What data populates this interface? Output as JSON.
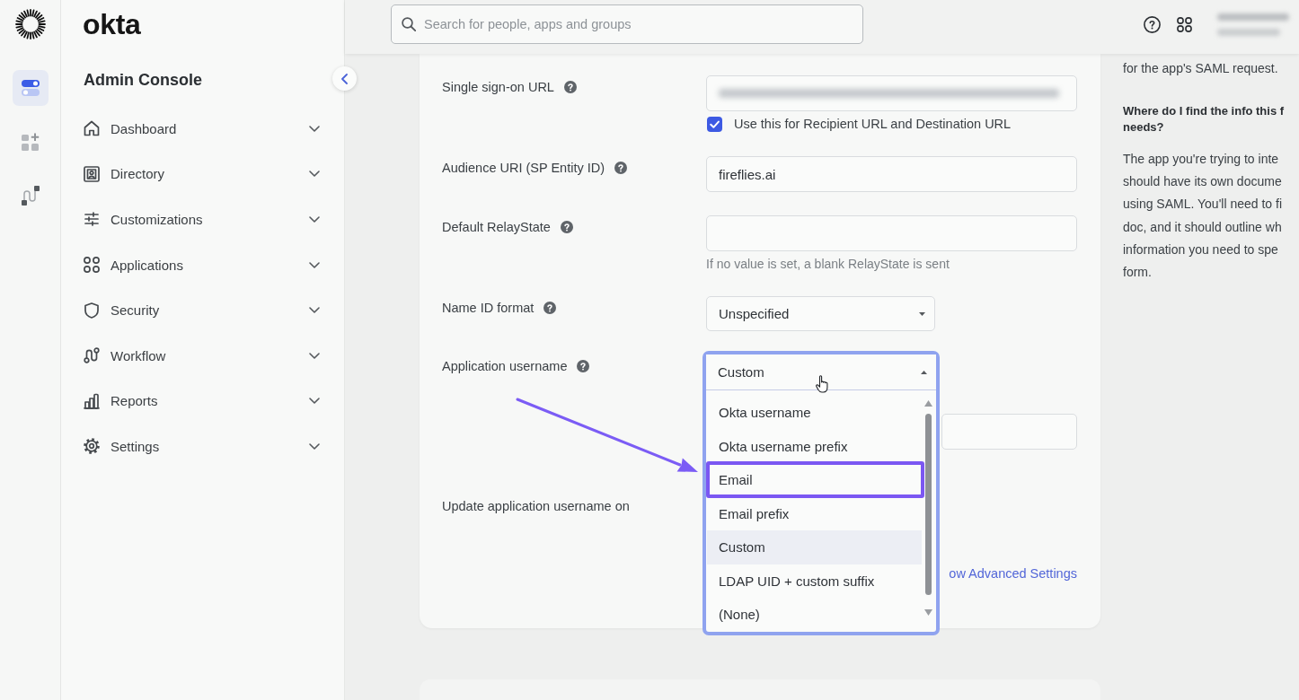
{
  "rail": {
    "items": [
      {
        "selected": true
      },
      {
        "selected": false
      },
      {
        "selected": false
      }
    ]
  },
  "sidebar": {
    "wordmark": "okta",
    "title": "Admin Console",
    "items": [
      {
        "label": "Dashboard",
        "expanded": false
      },
      {
        "label": "Directory",
        "expanded": false
      },
      {
        "label": "Customizations",
        "expanded": false
      },
      {
        "label": "Applications",
        "expanded": false
      },
      {
        "label": "Security",
        "expanded": false
      },
      {
        "label": "Workflow",
        "expanded": false
      },
      {
        "label": "Reports",
        "expanded": false
      },
      {
        "label": "Settings",
        "expanded": false
      }
    ]
  },
  "topbar": {
    "search": {
      "placeholder": "Search for people, apps and groups"
    }
  },
  "form": {
    "fields": [
      {
        "kind": "text",
        "label": "Single sign-on URL",
        "help": true,
        "redacted": true,
        "checkbox": {
          "label": "Use this for Recipient URL and Destination URL",
          "checked": true
        }
      },
      {
        "kind": "text",
        "label": "Audience URI (SP Entity ID)",
        "help": true,
        "value": "fireflies.ai"
      },
      {
        "kind": "text",
        "label": "Default RelayState",
        "help": true,
        "hint": "If no value is set, a blank RelayState is sent"
      },
      {
        "kind": "select",
        "label": "Name ID format",
        "help": true,
        "value": "Unspecified",
        "expanded": false
      },
      {
        "kind": "select",
        "label": "Application username",
        "help": true,
        "value": "Custom",
        "expanded": true,
        "custom_input": true,
        "options": [
          {
            "label": "Okta username",
            "selected": false,
            "annotated": false
          },
          {
            "label": "Okta username prefix",
            "selected": false,
            "annotated": false
          },
          {
            "label": "Email",
            "selected": false,
            "annotated": true
          },
          {
            "label": "Email prefix",
            "selected": false,
            "annotated": false
          },
          {
            "label": "Custom",
            "selected": true,
            "annotated": false
          },
          {
            "label": "LDAP UID + custom suffix",
            "selected": false,
            "annotated": false
          },
          {
            "label": "(None)",
            "selected": false,
            "annotated": false
          }
        ]
      },
      {
        "kind": "covered",
        "label": "Update application username on",
        "help": false
      }
    ],
    "advanced_link": "ow Advanced Settings"
  },
  "help_panel": {
    "intro_tail": "for the app's SAML request.",
    "heading": "Where do I find the info this f\nneeds?",
    "body": "The app you're trying to inte\nshould have its own docume\nusing SAML. You'll need to fi\ndoc, and it should outline wh\ninformation you need to spe\nform."
  }
}
